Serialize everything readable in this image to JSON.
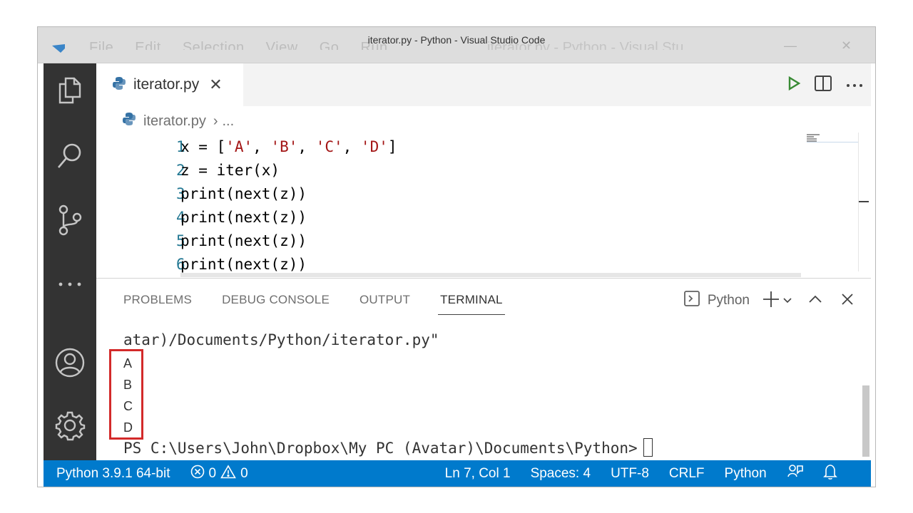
{
  "window": {
    "title": "iterator.py - Python - Visual Studio Code",
    "ghost_menu": [
      "File",
      "Edit",
      "Selection",
      "View",
      "Go",
      "Run"
    ],
    "ghost_title": "iterator.py - Python - Visual Stu..."
  },
  "tab": {
    "label": "iterator.py",
    "close_glyph": "✕"
  },
  "breadcrumb": {
    "file": "iterator.py",
    "separator": "›",
    "rest": "..."
  },
  "code_lines": [
    {
      "num": "1",
      "parts": [
        "x = [",
        "'A'",
        ", ",
        "'B'",
        ", ",
        "'C'",
        ", ",
        "'D'",
        "]"
      ]
    },
    {
      "num": "2",
      "text": "z = iter(x)"
    },
    {
      "num": "3",
      "text": "print(next(z))"
    },
    {
      "num": "4",
      "text": "print(next(z))"
    },
    {
      "num": "5",
      "text": "print(next(z))"
    },
    {
      "num": "6",
      "text": "print(next(z))"
    }
  ],
  "panel": {
    "tabs": [
      "PROBLEMS",
      "DEBUG CONSOLE",
      "OUTPUT",
      "TERMINAL"
    ],
    "active_tab": "TERMINAL",
    "terminal_selector": "Python"
  },
  "terminal": {
    "path_line": "atar)/Documents/Python/iterator.py\"",
    "outputs": [
      "A",
      "B",
      "C",
      "D"
    ],
    "prompt": "PS C:\\Users\\John\\Dropbox\\My PC (Avatar)\\Documents\\Python>"
  },
  "statusbar": {
    "interpreter": "Python 3.9.1 64-bit",
    "errors": "0",
    "warnings": "0",
    "position": "Ln 7, Col 1",
    "spaces": "Spaces: 4",
    "encoding": "UTF-8",
    "eol": "CRLF",
    "language": "Python"
  },
  "colors": {
    "activity_bar": "#333333",
    "status_bar": "#007acc",
    "highlight": "#d32a2a",
    "string": "#a31515",
    "line_number": "#237893",
    "run": "#388a34"
  }
}
